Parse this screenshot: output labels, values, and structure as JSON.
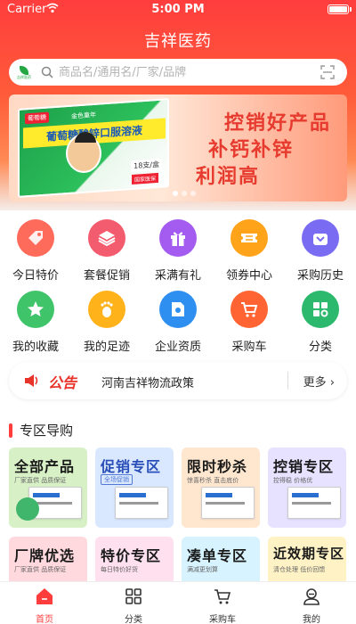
{
  "status_bar": {
    "carrier": "Carrier",
    "time": "5:00 PM"
  },
  "app": {
    "title": "吉祥医药"
  },
  "search": {
    "placeholder": "商品名/通用名/厂家/品牌",
    "logo_text": "吉祥医药"
  },
  "banner": {
    "box_brand": "葡萄糖",
    "box_title": "葡萄糖酸锌口服溶液",
    "box_sub": "金色童年",
    "box_count": "18支/盒",
    "box_tag": "国家医保",
    "lines": [
      "控销好产品",
      "补钙补锌",
      "利润高"
    ],
    "slides": 3,
    "active_slide": 0
  },
  "menu": {
    "items": [
      {
        "label": "今日特价",
        "icon": "tag-icon",
        "color": "#ff6b5a"
      },
      {
        "label": "套餐促销",
        "icon": "layers-icon",
        "color": "#f35b6e"
      },
      {
        "label": "采满有礼",
        "icon": "gift-icon",
        "color": "#a45cf0"
      },
      {
        "label": "领券中心",
        "icon": "ticket-icon",
        "color": "#ffa31a"
      },
      {
        "label": "采购历史",
        "icon": "basket-icon",
        "color": "#7a6cf2"
      },
      {
        "label": "我的收藏",
        "icon": "star-icon",
        "color": "#3fc46a"
      },
      {
        "label": "我的足迹",
        "icon": "footprint-icon",
        "color": "#ffb21a"
      },
      {
        "label": "企业资质",
        "icon": "certificate-icon",
        "color": "#2f8ff0"
      },
      {
        "label": "采购车",
        "icon": "cart-icon",
        "color": "#ff6432"
      },
      {
        "label": "分类",
        "icon": "category-icon",
        "color": "#2cb86d"
      }
    ]
  },
  "notice": {
    "badge": "公告",
    "text": "河南吉祥物流政策",
    "more": "更多"
  },
  "zone": {
    "title": "专区导购",
    "cards": [
      {
        "title": "全部产品",
        "sub": "厂家直供 品质保证",
        "title_color": "#1a1a1a",
        "bg": "#d7f0c6"
      },
      {
        "title": "促销专区",
        "sub": "全场促销",
        "title_color": "#2a4fb8",
        "bg": "#d9e8ff"
      },
      {
        "title": "限时秒杀",
        "sub": "惊喜秒杀 直击底价",
        "title_color": "#1a1a1a",
        "bg": "#ffe7cf"
      },
      {
        "title": "控销专区",
        "sub": "控得稳 价格优",
        "title_color": "#1a1a1a",
        "bg": "#e6e2ff"
      },
      {
        "title": "厂牌优选",
        "sub": "厂家直供 品质保证",
        "title_color": "#1a1a1a",
        "bg": "#ffd9dd"
      },
      {
        "title": "特价专区",
        "sub": "每日特价好货",
        "title_color": "#1a1a1a",
        "bg": "#ffe0ee"
      },
      {
        "title": "凑单专区",
        "sub": "满减更划算",
        "title_color": "#1a1a1a",
        "bg": "#d6f3ff"
      },
      {
        "title": "近效期专区",
        "sub": "清仓处理 低价回馈",
        "title_color": "#1a1a1a",
        "bg": "#fff3c6"
      }
    ]
  },
  "tabbar": {
    "tabs": [
      {
        "label": "首页",
        "icon": "home-icon",
        "active": true
      },
      {
        "label": "分类",
        "icon": "grid-icon",
        "active": false
      },
      {
        "label": "采购车",
        "icon": "cart-icon",
        "active": false
      },
      {
        "label": "我的",
        "icon": "user-icon",
        "active": false
      }
    ]
  },
  "colors": {
    "primary": "#ff3d3d",
    "accent": "#e8332a"
  }
}
